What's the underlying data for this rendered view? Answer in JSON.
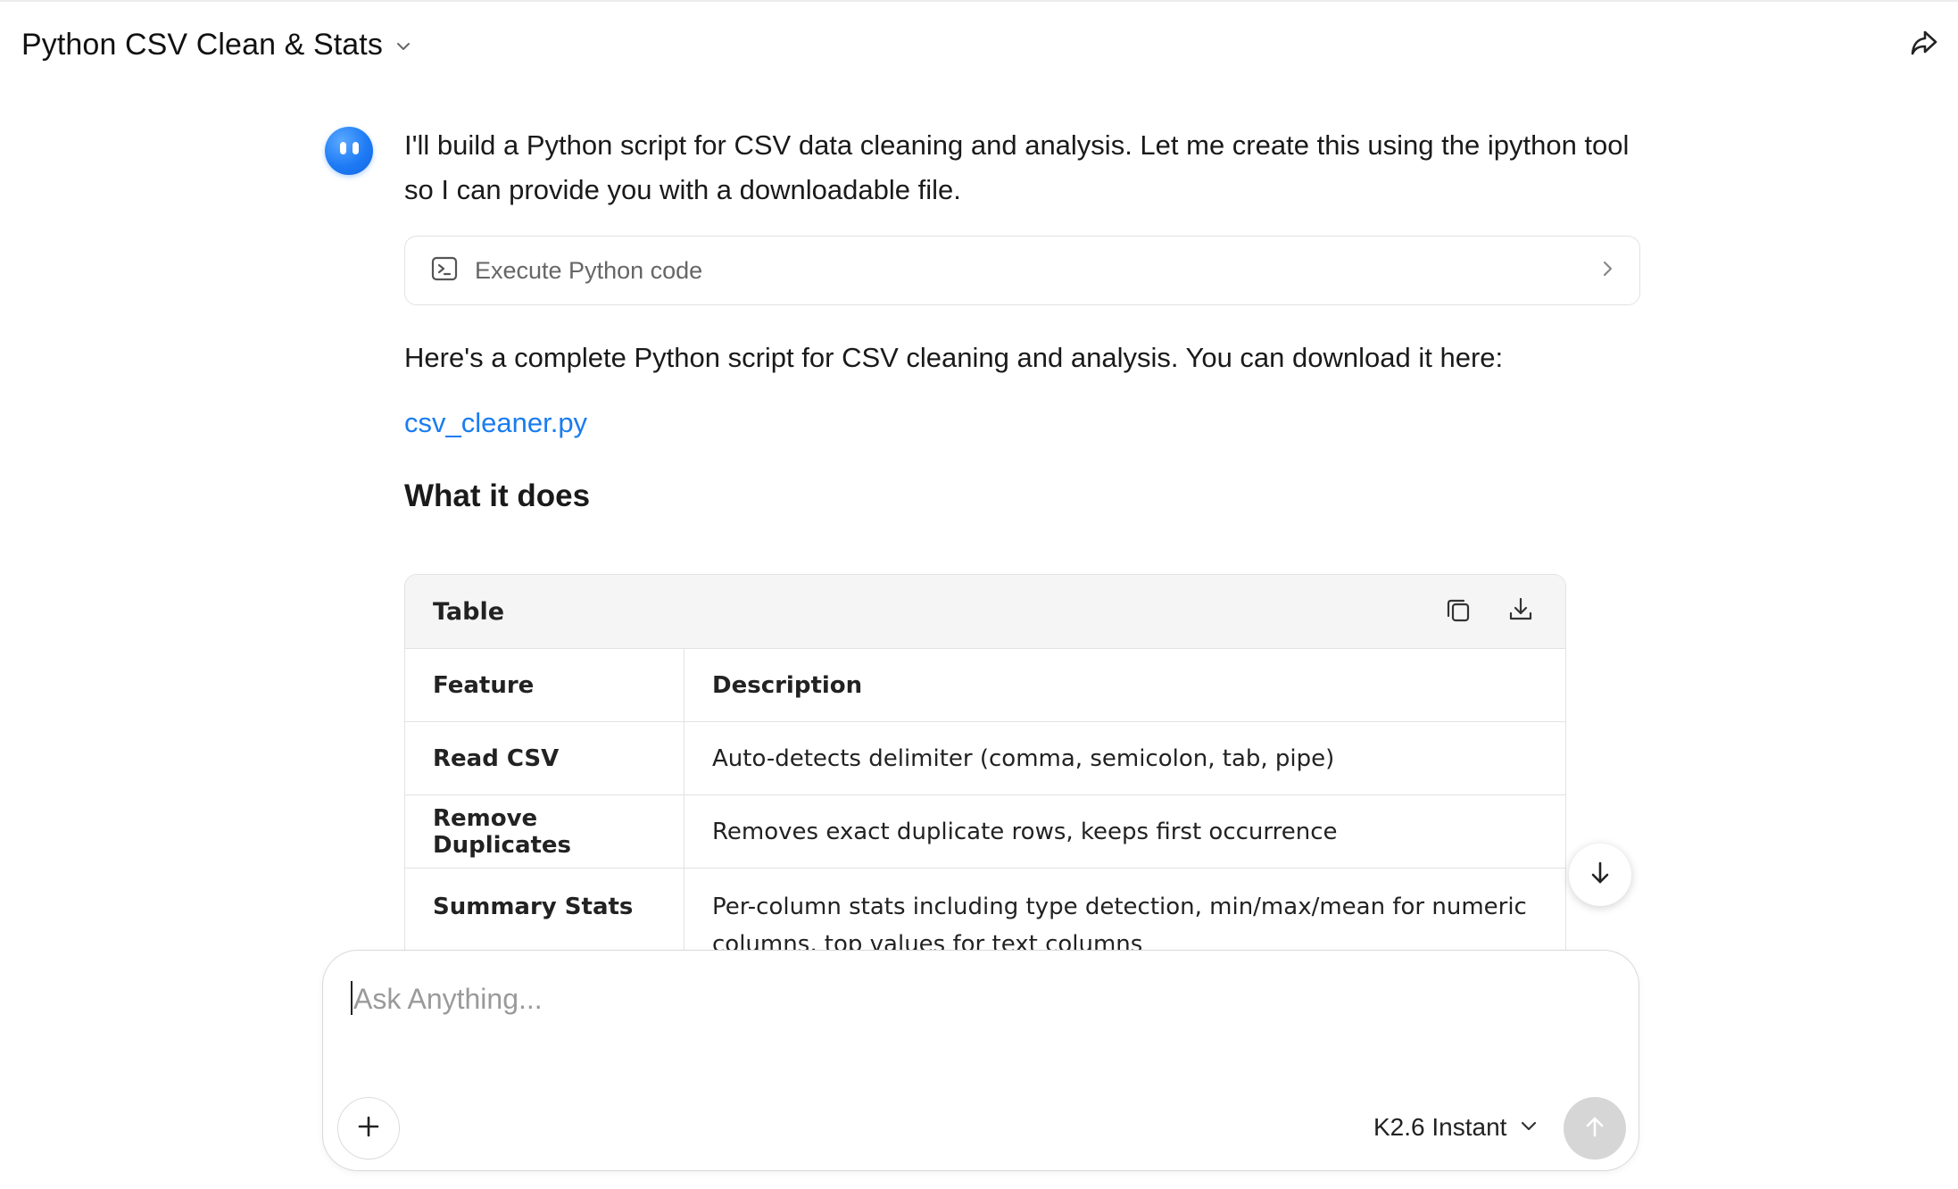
{
  "header": {
    "title": "Python CSV Clean & Stats",
    "title_menu_icon": "chevron-down-icon",
    "share_icon": "share-icon"
  },
  "message": {
    "avatar_icon": "assistant-avatar-icon",
    "intro": "I'll build a Python script for CSV data cleaning and analysis. Let me create this using the ipython tool so I can provide you with a downloadable file.",
    "tool_call": {
      "icon": "terminal-icon",
      "label": "Execute Python code",
      "expand_icon": "chevron-right-icon"
    },
    "body": "Here's a complete Python script for CSV cleaning and analysis. You can download it here:",
    "file_link": "csv_cleaner.py",
    "section_heading": "What it does",
    "table": {
      "label": "Table",
      "copy_icon": "copy-icon",
      "download_icon": "download-icon",
      "columns": [
        "Feature",
        "Description"
      ],
      "rows": [
        [
          "Read CSV",
          "Auto-detects delimiter (comma, semicolon, tab, pipe)"
        ],
        [
          "Remove Duplicates",
          "Removes exact duplicate rows, keeps first occurrence"
        ],
        [
          "Summary Stats",
          "Per-column stats including type detection, min/max/mean for numeric columns, top values for text columns"
        ]
      ]
    }
  },
  "scroll_button_icon": "arrow-down-icon",
  "composer": {
    "placeholder": "Ask Anything...",
    "value": "",
    "add_icon": "plus-icon",
    "model": "K2.6 Instant",
    "model_menu_icon": "chevron-down-icon",
    "send_icon": "arrow-up-icon"
  },
  "colors": {
    "accent_link": "#1a7cf0",
    "avatar": "#1e7bf5",
    "send_disabled": "#d6d6d6"
  }
}
